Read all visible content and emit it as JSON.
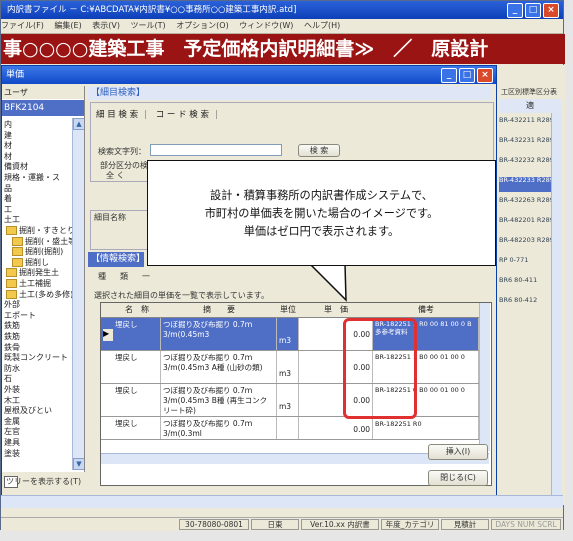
{
  "window": {
    "title": "内訳書ファイル － C:¥ABCDATA¥内訳書¥○○事務所○○建築工事内訳.atd]",
    "menu": [
      "ファイル(F)",
      "編集(E)",
      "表示(V)",
      "ツール(T)",
      "オプション(O)",
      "ウィンドウ(W)",
      "ヘルプ(H)"
    ]
  },
  "banner": {
    "text": "事○○○○建築工事　予定価格内訳明細書≫　／　原設計"
  },
  "dialog": {
    "title": "単価",
    "tree": {
      "header": "ユーザ",
      "code": "BFK2104",
      "items": [
        "内",
        "建",
        "材",
        "材",
        "備資材",
        "規格・運搬・ス",
        "品",
        "着",
        "工",
        "土工",
        "掘削・すきとり",
        "掘削(・盛土等",
        "掘削(掘削)",
        "掘削し",
        "掘削発生土",
        "土工補掘",
        "土工(多め多修)",
        "外部",
        "エポート",
        "鉄筋",
        "鉄筋",
        "鉄骨",
        "既製コンクリート",
        "防水",
        "石",
        "外装",
        "木工",
        "屋根及びとい",
        "金属",
        "左官",
        "建具",
        "塗装"
      ],
      "show_label": "ツリーを表示する(T)"
    },
    "panel_title": "【細目検索】",
    "tabs": {
      "left": "細 目 検 索",
      "right": "コ ー ド 検 索"
    },
    "search_label": "検索文字列：",
    "search_button": "検 索",
    "scope_label": "部分区分の検索",
    "scope_options": [
      "全 く",
      "前方"
    ],
    "name_header": "細目名称",
    "info_title": "【情報検索】",
    "info_tabs": [
      "種",
      "類",
      "一"
    ],
    "list_caption": "選択された細目の単価を一覧で表示しています。",
    "columns": [
      "名　称",
      "摘　　要",
      "単位",
      "単　価",
      "備考"
    ],
    "rows": [
      {
        "name": "埋戻し",
        "spec": "つぼ掘り及び布掘り 0.7ｍ3/m(0.45m3",
        "unit": "m3",
        "price": "0.00",
        "note": "BR-182251 1 R0 00 81 00 0 B多参考資料"
      },
      {
        "name": "埋戻し",
        "spec": "つぼ掘り及び布掘り 0.7ｍ3/m(0.45m3 A種 (山砂の類)",
        "unit": "m3",
        "price": "0.00",
        "note": "BR-182251 1 B0 00 01 00 0"
      },
      {
        "name": "埋戻し",
        "spec": "つぼ掘り及び布掘り 0.7ｍ3/m(0.45m3 B種 (再生コンクリート砕)",
        "unit": "m3",
        "price": "0.00",
        "note": "BR-182251 0 B0 00 01 00 0"
      },
      {
        "name": "埋戻し",
        "spec": "つぼ掘り及び布掘り 0.7ｍ3/m(0.3ml",
        "unit": "",
        "price": "0.00",
        "note": "BR-182251 R0"
      }
    ],
    "insert_button": "挿入(I)",
    "close_button": "閉じる(C)"
  },
  "right_panel": {
    "header": "工区別標準区分表",
    "subheader": "適",
    "rows": [
      "BR-432211 R2894",
      "BR-432231 R2894",
      "BR-432232 R2894",
      "BR-432233 R2894",
      "BR-432263 R2894",
      "BR-482201 R2894",
      "BR-482203 R2894",
      "RP 0-771",
      "BR6 80-411",
      "BR6 80-412"
    ]
  },
  "status": [
    "30-78080-0801",
    "日東",
    "Ver.10.xx 内訳書",
    "年度_カテゴリ",
    "見積計",
    "DAYS NUM SCRL"
  ],
  "callout": {
    "lines": [
      "設計・積算事務所の内訳書作成システムで、",
      "市町村の単価表を開いた場合のイメージです。",
      "単価はゼロ円で表示されます。"
    ]
  },
  "colors": {
    "banner": "#9b1414",
    "title_blue": "#1149c8",
    "highlight": "#4f6ec6",
    "red_box": "#e03030"
  }
}
